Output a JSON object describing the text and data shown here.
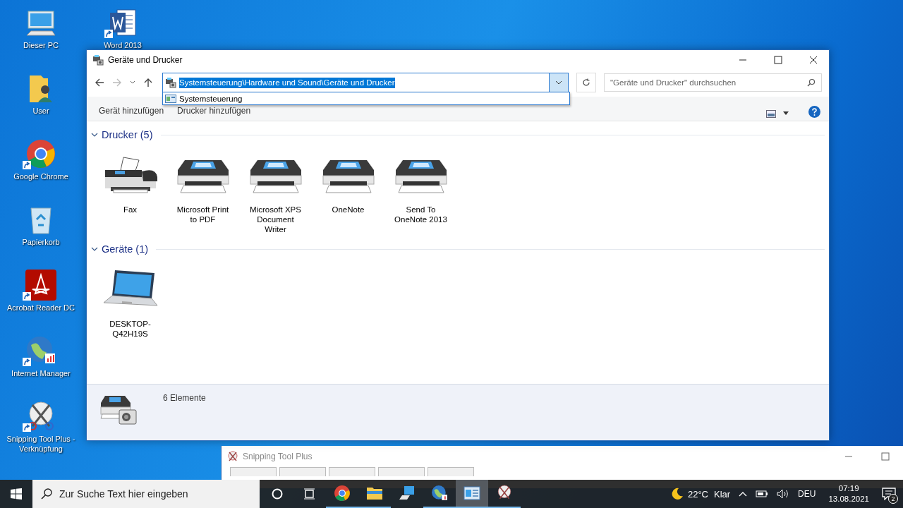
{
  "desktop_columns": [
    {
      "icons": [
        {
          "label": "Dieser PC",
          "kind": "pc",
          "shortcut": false
        },
        {
          "label": "User",
          "kind": "user-folder",
          "shortcut": false
        },
        {
          "label": "Google Chrome",
          "kind": "chrome",
          "shortcut": true
        },
        {
          "label": "Papierkorb",
          "kind": "bin",
          "shortcut": false
        },
        {
          "label": "Acrobat Reader DC",
          "kind": "acrobat",
          "shortcut": true
        },
        {
          "label": "Internet Manager",
          "kind": "globe",
          "shortcut": true
        },
        {
          "label": "Snipping Tool Plus - Verknüpfung",
          "kind": "snip",
          "shortcut": true
        }
      ]
    },
    {
      "icons": [
        {
          "label": "Word 2013",
          "kind": "word",
          "shortcut": true
        }
      ]
    }
  ],
  "window": {
    "title": "Geräte und Drucker",
    "nav": {
      "back_disabled": false,
      "forward_disabled": true
    },
    "address": {
      "value": "Systemsteuerung\\Hardware und Sound\\Geräte und Drucker",
      "selected": true,
      "expanded": true,
      "suggestions": [
        "Systemsteuerung"
      ]
    },
    "search": {
      "placeholder": "\"Geräte und Drucker\" durchsuchen"
    },
    "commands": [
      "Gerät hinzufügen",
      "Drucker hinzufügen"
    ],
    "groups": [
      {
        "title": "Drucker (5)",
        "expanded": true,
        "items": [
          {
            "label": "Fax",
            "kind": "fax"
          },
          {
            "label": "Microsoft Print to PDF",
            "kind": "printer"
          },
          {
            "label": "Microsoft XPS Document Writer",
            "kind": "printer"
          },
          {
            "label": "OneNote",
            "kind": "printer"
          },
          {
            "label": "Send To OneNote 2013",
            "kind": "printer"
          }
        ]
      },
      {
        "title": "Geräte (1)",
        "expanded": true,
        "items": [
          {
            "label": "DESKTOP-Q42H19S",
            "kind": "laptop"
          }
        ]
      }
    ],
    "status": "6 Elemente"
  },
  "background_window": {
    "title": "Snipping Tool Plus"
  },
  "taskbar": {
    "search": {
      "placeholder": "Zur Suche Text hier eingeben"
    },
    "apps": [
      {
        "kind": "chrome",
        "running": true,
        "active": false
      },
      {
        "kind": "folder",
        "running": true,
        "active": false
      },
      {
        "kind": "pc",
        "running": false,
        "active": false
      },
      {
        "kind": "globe",
        "running": true,
        "active": false
      },
      {
        "kind": "panel",
        "running": true,
        "active": true
      },
      {
        "kind": "snip",
        "running": true,
        "active": false
      }
    ],
    "temperature": "22°C",
    "weather": "Klar",
    "language": "DEU",
    "time": "07:19",
    "date": "13.08.2021",
    "notifications": "2"
  }
}
